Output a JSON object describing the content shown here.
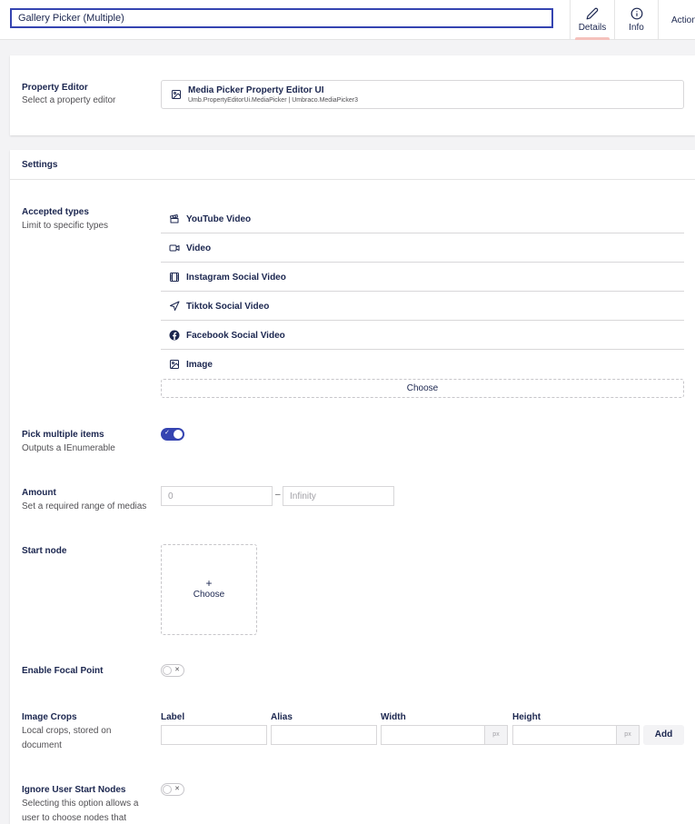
{
  "header": {
    "name_value": "Gallery Picker (Multiple)",
    "tabs": [
      {
        "label": "Details",
        "icon": "pencil-icon"
      },
      {
        "label": "Info",
        "icon": "info-icon"
      },
      {
        "label": "Actions"
      }
    ]
  },
  "property_editor": {
    "label": "Property Editor",
    "description": "Select a property editor",
    "name": "Media Picker Property Editor UI",
    "alias": "Umb.PropertyEditorUi.MediaPicker | Umbraco.MediaPicker3"
  },
  "settings": {
    "title": "Settings",
    "accepted_types": {
      "label": "Accepted types",
      "description": "Limit to specific types",
      "items": [
        {
          "name": "YouTube Video",
          "icon": "clapperboard-icon"
        },
        {
          "name": "Video",
          "icon": "video-camera-icon"
        },
        {
          "name": "Instagram Social Video",
          "icon": "film-icon"
        },
        {
          "name": "Tiktok Social Video",
          "icon": "send-icon"
        },
        {
          "name": "Facebook Social Video",
          "icon": "facebook-icon"
        },
        {
          "name": "Image",
          "icon": "image-icon"
        }
      ],
      "choose_label": "Choose"
    },
    "pick_multiple": {
      "label": "Pick multiple items",
      "description": "Outputs a IEnumerable",
      "checked": true
    },
    "amount": {
      "label": "Amount",
      "description": "Set a required range of medias",
      "min_placeholder": "0",
      "separator": "–",
      "max_placeholder": "Infinity"
    },
    "start_node": {
      "label": "Start node",
      "plus": "+",
      "choose_label": "Choose"
    },
    "focal_point": {
      "label": "Enable Focal Point",
      "checked": false
    },
    "image_crops": {
      "label": "Image Crops",
      "description": "Local crops, stored on document",
      "columns": [
        "Label",
        "Alias",
        "Width",
        "Height"
      ],
      "unit": "px",
      "add_label": "Add"
    },
    "ignore_start_nodes": {
      "label": "Ignore User Start Nodes",
      "description": "Selecting this option allows a user to choose nodes that",
      "checked": false
    }
  },
  "colors": {
    "primary": "#3544b1",
    "text": "#1b264f",
    "active_tab_indicator": "#f5c1bc"
  }
}
